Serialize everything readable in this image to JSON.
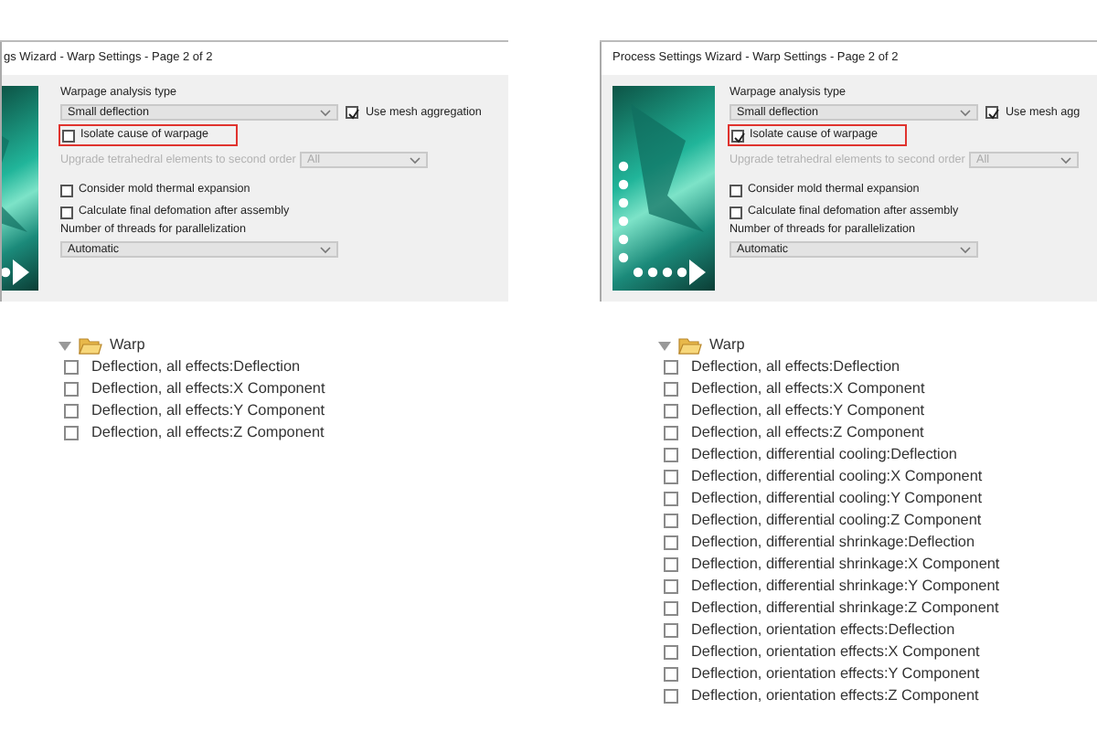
{
  "panels": [
    {
      "dialog": {
        "title": "gs Wizard - Warp Settings - Page 2 of 2",
        "analysis_type_label": "Warpage analysis type",
        "analysis_type": "Small deflection",
        "mesh_aggregation": {
          "label": "Use mesh aggregation",
          "checked": true
        },
        "isolate": {
          "label": "Isolate cause of warpage",
          "checked": false,
          "highlighted": true
        },
        "upgrade": {
          "label": "Upgrade tetrahedral elements to second order",
          "disabled": true,
          "value": "All"
        },
        "mold_expansion": {
          "label": "Consider mold thermal expansion",
          "checked": false
        },
        "final_deformation": {
          "label": "Calculate final defomation after assembly",
          "checked": false
        },
        "threads_label": "Number of threads for parallelization",
        "threads": "Automatic"
      },
      "tree": {
        "label": "Warp",
        "expanded": true,
        "children": [
          {
            "label": "Deflection, all effects:Deflection",
            "checked": false
          },
          {
            "label": "Deflection, all effects:X Component",
            "checked": false
          },
          {
            "label": "Deflection, all effects:Y Component",
            "checked": false
          },
          {
            "label": "Deflection, all effects:Z Component",
            "checked": false
          }
        ]
      }
    },
    {
      "dialog": {
        "title": "Process Settings Wizard - Warp Settings - Page 2 of 2",
        "analysis_type_label": "Warpage analysis type",
        "analysis_type": "Small deflection",
        "mesh_aggregation": {
          "label": "Use mesh agg",
          "checked": true
        },
        "isolate": {
          "label": "Isolate cause of warpage",
          "checked": true,
          "highlighted": true
        },
        "upgrade": {
          "label": "Upgrade tetrahedral elements to second order",
          "disabled": true,
          "value": "All"
        },
        "mold_expansion": {
          "label": "Consider mold thermal expansion",
          "checked": false
        },
        "final_deformation": {
          "label": "Calculate final defomation after assembly",
          "checked": false
        },
        "threads_label": "Number of threads for parallelization",
        "threads": "Automatic"
      },
      "tree": {
        "label": "Warp",
        "expanded": true,
        "children": [
          {
            "label": "Deflection, all effects:Deflection",
            "checked": false
          },
          {
            "label": "Deflection, all effects:X Component",
            "checked": false
          },
          {
            "label": "Deflection, all effects:Y Component",
            "checked": false
          },
          {
            "label": "Deflection, all effects:Z Component",
            "checked": false
          },
          {
            "label": "Deflection, differential cooling:Deflection",
            "checked": false
          },
          {
            "label": "Deflection, differential cooling:X Component",
            "checked": false
          },
          {
            "label": "Deflection, differential cooling:Y Component",
            "checked": false
          },
          {
            "label": "Deflection, differential cooling:Z Component",
            "checked": false
          },
          {
            "label": "Deflection, differential shrinkage:Deflection",
            "checked": false
          },
          {
            "label": "Deflection, differential shrinkage:X Component",
            "checked": false
          },
          {
            "label": "Deflection, differential shrinkage:Y Component",
            "checked": false
          },
          {
            "label": "Deflection, differential shrinkage:Z Component",
            "checked": false
          },
          {
            "label": "Deflection, orientation effects:Deflection",
            "checked": false
          },
          {
            "label": "Deflection, orientation effects:X Component",
            "checked": false
          },
          {
            "label": "Deflection, orientation effects:Y Component",
            "checked": false
          },
          {
            "label": "Deflection, orientation effects:Z Component",
            "checked": false
          }
        ]
      }
    }
  ]
}
